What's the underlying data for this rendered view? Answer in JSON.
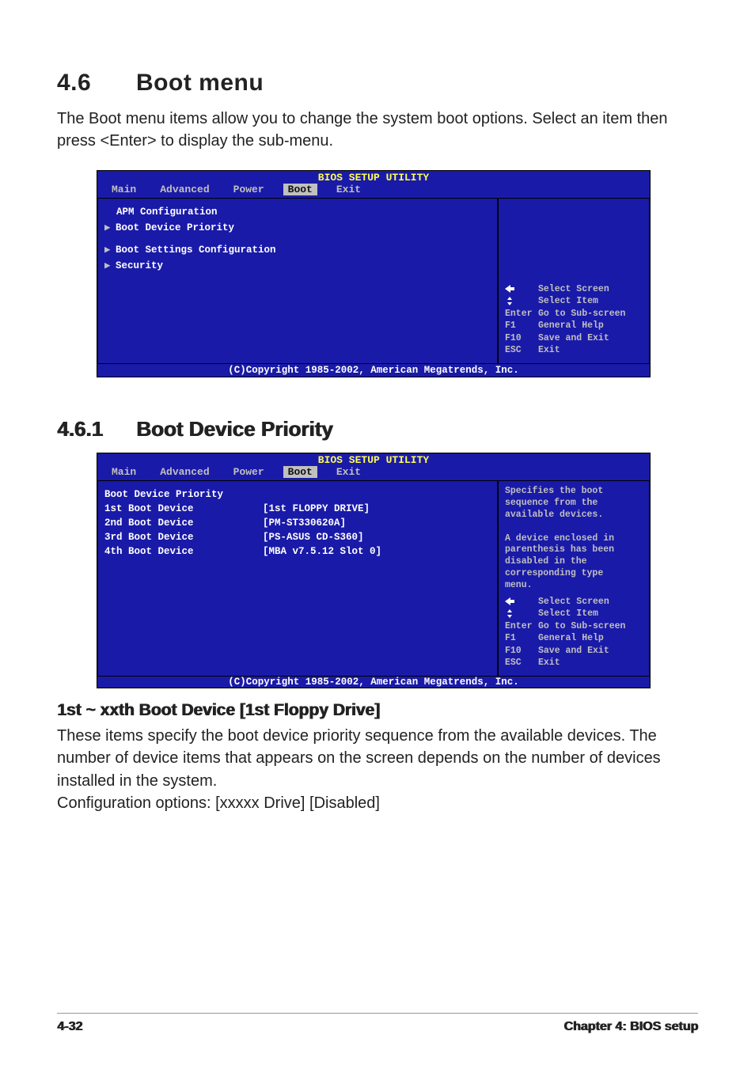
{
  "section": {
    "number": "4.6",
    "title": "Boot menu"
  },
  "intro": "The Boot menu items allow you to change the system boot options. Select an item then press <Enter> to display the sub-menu.",
  "bios1": {
    "title": "BIOS SETUP UTILITY",
    "tabs": [
      "Main",
      "Advanced",
      "Power",
      "Boot",
      "Exit"
    ],
    "active_tab": "Boot",
    "items": {
      "apm": "APM Configuration",
      "priority": "Boot Device Priority",
      "settings": "Boot Settings Configuration",
      "security": "Security"
    },
    "legend": {
      "select_screen": "Select Screen",
      "select_item": "Select Item",
      "enter_k": "Enter",
      "enter_v": "Go to Sub-screen",
      "f1_k": "F1",
      "f1_v": "General Help",
      "f10_k": "F10",
      "f10_v": "Save and Exit",
      "esc_k": "ESC",
      "esc_v": "Exit"
    },
    "footer": "(C)Copyright 1985-2002, American Megatrends, Inc."
  },
  "subsection": {
    "number": "4.6.1",
    "title": "Boot Device Priority"
  },
  "bios2": {
    "title": "BIOS SETUP UTILITY",
    "tabs": [
      "Main",
      "Advanced",
      "Power",
      "Boot",
      "Exit"
    ],
    "active_tab": "Boot",
    "heading": "Boot Device Priority",
    "rows": [
      {
        "label": "1st Boot Device",
        "value": "[1st FLOPPY DRIVE]"
      },
      {
        "label": "2nd Boot Device",
        "value": "[PM-ST330620A]"
      },
      {
        "label": "3rd Boot Device",
        "value": "[PS-ASUS CD-S360]"
      },
      {
        "label": "4th Boot Device",
        "value": "[MBA v7.5.12 Slot 0]"
      }
    ],
    "help": [
      "Specifies the boot",
      "sequence from the",
      "available devices.",
      "",
      "A device enclosed in",
      "parenthesis has been",
      "disabled in the",
      "corresponding type",
      "menu."
    ],
    "legend": {
      "select_screen": "Select Screen",
      "select_item": "Select Item",
      "enter_k": "Enter",
      "enter_v": "Go to Sub-screen",
      "f1_k": "F1",
      "f1_v": "General Help",
      "f10_k": "F10",
      "f10_v": "Save and Exit",
      "esc_k": "ESC",
      "esc_v": "Exit"
    },
    "footer": "(C)Copyright 1985-2002, American Megatrends, Inc."
  },
  "option_heading": "1st ~ xxth Boot Device [1st Floppy Drive]",
  "option_para1": "These items specify the boot device priority sequence from the available devices. The number of device items that appears on the screen depends on the number of devices installed in the system.",
  "option_para2": "Configuration options: [xxxxx Drive] [Disabled]",
  "footer": {
    "page": "4-32",
    "chapter": "Chapter 4: BIOS setup"
  }
}
